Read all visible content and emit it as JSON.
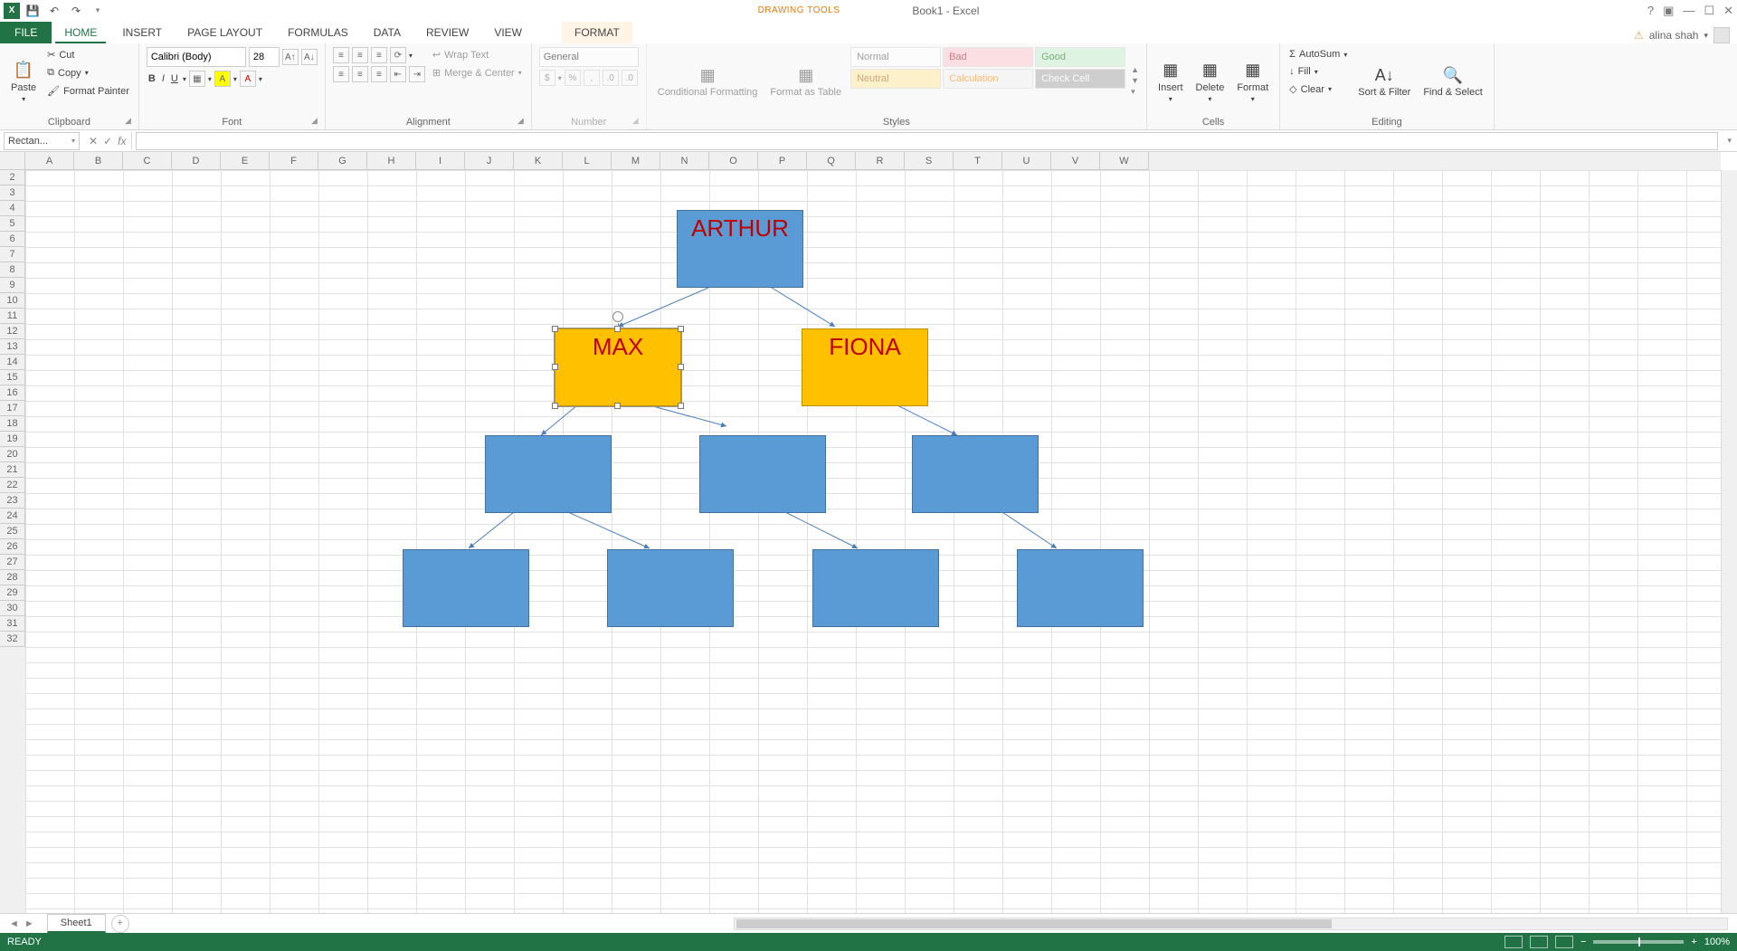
{
  "title": "Book1 - Excel",
  "contextual_tab_group": "DRAWING TOOLS",
  "user": {
    "name": "alina shah"
  },
  "qat": {
    "save": "💾",
    "undo": "↶",
    "redo": "↷"
  },
  "tabs": {
    "file": "FILE",
    "home": "HOME",
    "insert": "INSERT",
    "page_layout": "PAGE LAYOUT",
    "formulas": "FORMULAS",
    "data": "DATA",
    "review": "REVIEW",
    "view": "VIEW",
    "format": "FORMAT"
  },
  "ribbon": {
    "clipboard": {
      "label": "Clipboard",
      "paste": "Paste",
      "cut": "Cut",
      "copy": "Copy",
      "painter": "Format Painter"
    },
    "font": {
      "label": "Font",
      "name": "Calibri (Body)",
      "size": "28",
      "bold": "B",
      "italic": "I",
      "underline": "U"
    },
    "alignment": {
      "label": "Alignment",
      "wrap": "Wrap Text",
      "merge": "Merge & Center"
    },
    "number": {
      "label": "Number",
      "format": "General"
    },
    "styles": {
      "label": "Styles",
      "conditional": "Conditional Formatting",
      "table": "Format as Table",
      "normal": "Normal",
      "bad": "Bad",
      "good": "Good",
      "neutral": "Neutral",
      "calculation": "Calculation",
      "check": "Check Cell"
    },
    "cells": {
      "label": "Cells",
      "insert": "Insert",
      "delete": "Delete",
      "format": "Format"
    },
    "editing": {
      "label": "Editing",
      "autosum": "AutoSum",
      "fill": "Fill",
      "clear": "Clear",
      "sort": "Sort & Filter",
      "find": "Find & Select"
    }
  },
  "namebox": "Rectan...",
  "columns": [
    "A",
    "B",
    "C",
    "D",
    "E",
    "F",
    "G",
    "H",
    "I",
    "J",
    "K",
    "L",
    "M",
    "N",
    "O",
    "P",
    "Q",
    "R",
    "S",
    "T",
    "U",
    "V",
    "W"
  ],
  "rows_start": 2,
  "rows_end": 32,
  "shapes": {
    "arthur": "ARTHUR",
    "max": "MAX",
    "fiona": "FIONA"
  },
  "sheet": {
    "name": "Sheet1",
    "status": "READY",
    "zoom": "100%"
  }
}
